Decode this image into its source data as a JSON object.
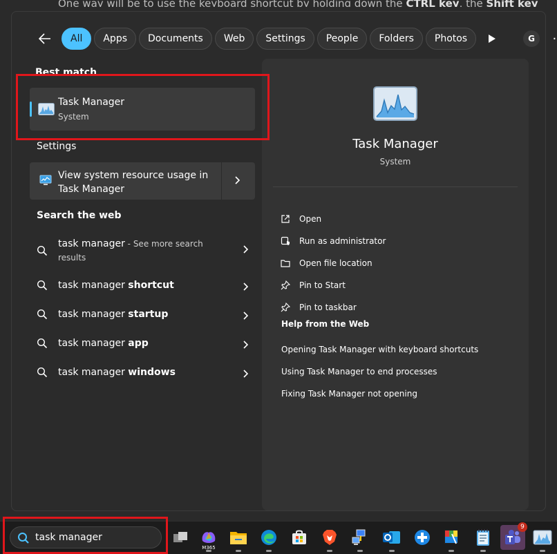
{
  "background": {
    "text_prefix": "One way will be to use the keyboard shortcut by holding down the ",
    "bold1": "CTRL key",
    "middle": ", the ",
    "bold2": "Shift key"
  },
  "filters": {
    "items": [
      "All",
      "Apps",
      "Documents",
      "Web",
      "Settings",
      "People",
      "Folders",
      "Photos"
    ],
    "active": "All",
    "account_initial": "G",
    "more_label": "···"
  },
  "best_match": {
    "label": "Best match",
    "title": "Task Manager",
    "subtitle": "System"
  },
  "settings": {
    "label": "Settings",
    "item": "View system resource usage in Task Manager"
  },
  "search_web": {
    "label": "Search the web",
    "first": {
      "query": "task manager",
      "suffix": " - See more search results"
    },
    "rows": [
      {
        "prefix": "task manager ",
        "bold": "shortcut"
      },
      {
        "prefix": "task manager ",
        "bold": "startup"
      },
      {
        "prefix": "task manager ",
        "bold": "app"
      },
      {
        "prefix": "task manager ",
        "bold": "windows"
      }
    ]
  },
  "detail": {
    "title": "Task Manager",
    "subtitle": "System",
    "actions": [
      "Open",
      "Run as administrator",
      "Open file location",
      "Pin to Start",
      "Pin to taskbar"
    ],
    "help_heading": "Help from the Web",
    "help_links": [
      "Opening Task Manager with keyboard shortcuts",
      "Using Task Manager to end processes",
      "Fixing Task Manager not opening"
    ]
  },
  "taskbar": {
    "search_value": "task manager",
    "m365_label": "M365",
    "teams_badge": "9"
  },
  "colors": {
    "accent": "#4cc2ff",
    "highlight": "#e0161b"
  }
}
